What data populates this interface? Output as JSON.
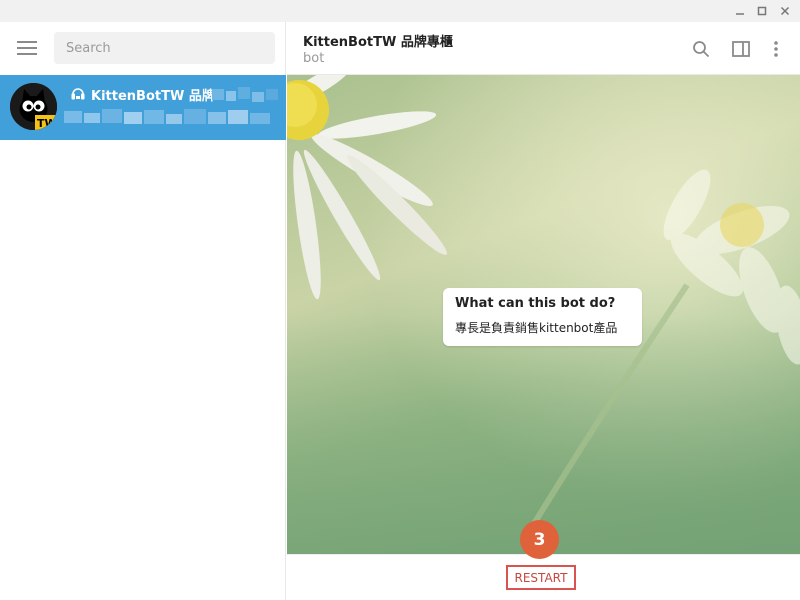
{
  "window": {
    "controls": {
      "minimize_icon": "minimize-icon",
      "maximize_icon": "maximize-icon",
      "close_icon": "close-icon"
    }
  },
  "sidebar": {
    "menu_icon": "hamburger-menu-icon",
    "search": {
      "placeholder": "Search",
      "value": ""
    },
    "chats": [
      {
        "title": "KittenBotTW 品牌...",
        "icon": "bot-icon",
        "avatar": "kittenbot-cat-avatar",
        "preview_blurred": true
      }
    ]
  },
  "header": {
    "title": "KittenBotTW 品牌專櫃",
    "status": "bot",
    "icons": [
      "search-icon",
      "sidebar-toggle-icon",
      "more-vertical-icon"
    ]
  },
  "bot_info": {
    "question": "What can this bot do?",
    "answer": "專長是負責銷售kittenbot產品"
  },
  "bottom": {
    "restart_label": "RESTART"
  },
  "annotation": {
    "step": "3",
    "color": "#e0623a"
  },
  "colors": {
    "accent": "#419fd9",
    "restart": "#d9534f"
  }
}
